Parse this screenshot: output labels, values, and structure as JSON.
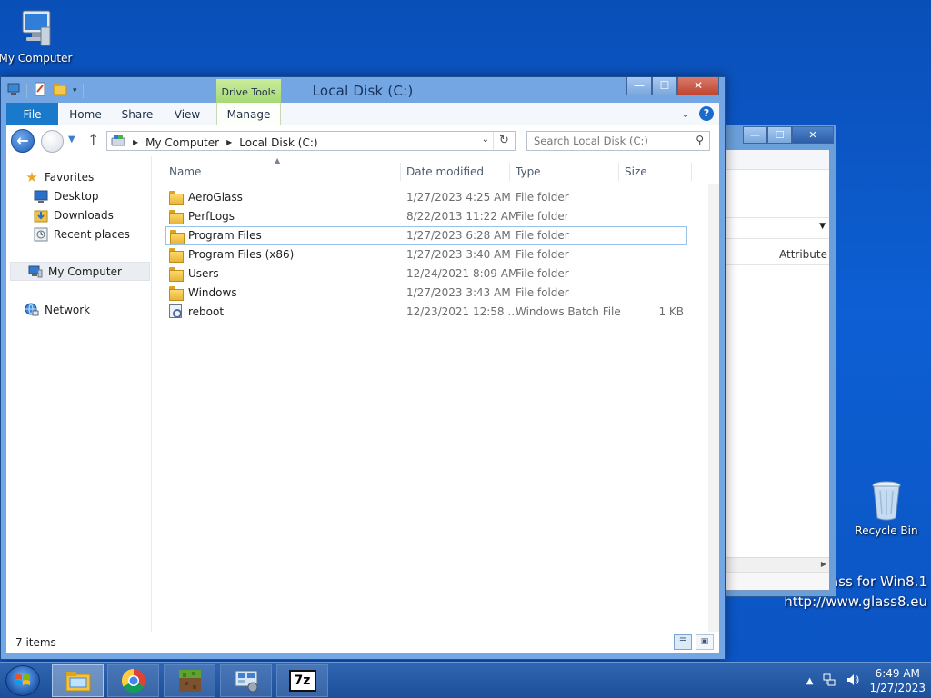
{
  "desktop": {
    "icons": [
      {
        "label": "My Computer"
      },
      {
        "label": "Recycle Bin"
      }
    ],
    "watermark": {
      "line1": "Glass for Win8.1",
      "line2": "http://www.glass8.eu"
    }
  },
  "background_window": {
    "column_header": "Attribute",
    "buttons": {
      "minimize": "—",
      "maximize": "☐",
      "close": "✕"
    }
  },
  "window": {
    "title": "Local Disk (C:)",
    "context_tab": "Drive Tools",
    "tabs": [
      "File",
      "Home",
      "Share",
      "View",
      "Manage"
    ],
    "buttons": {
      "minimize": "—",
      "maximize": "☐",
      "close": "✕"
    },
    "help": "?",
    "collapse": "⌄"
  },
  "address": {
    "crumbs": [
      "My Computer",
      "Local Disk (C:)"
    ],
    "back": "←",
    "up": "↑",
    "refresh": "↻"
  },
  "search": {
    "placeholder": "Search Local Disk (C:)"
  },
  "nav_pane": {
    "favorites_label": "Favorites",
    "favorites": [
      "Desktop",
      "Downloads",
      "Recent places"
    ],
    "computer": "My Computer",
    "network": "Network"
  },
  "columns": [
    "Name",
    "Date modified",
    "Type",
    "Size"
  ],
  "files": [
    {
      "name": "AeroGlass",
      "date": "1/27/2023 4:25 AM",
      "type": "File folder",
      "size": "",
      "kind": "folder"
    },
    {
      "name": "PerfLogs",
      "date": "8/22/2013 11:22 AM",
      "type": "File folder",
      "size": "",
      "kind": "folder"
    },
    {
      "name": "Program Files",
      "date": "1/27/2023 6:28 AM",
      "type": "File folder",
      "size": "",
      "kind": "folder",
      "focused": true
    },
    {
      "name": "Program Files (x86)",
      "date": "1/27/2023 3:40 AM",
      "type": "File folder",
      "size": "",
      "kind": "folder"
    },
    {
      "name": "Users",
      "date": "12/24/2021 8:09 AM",
      "type": "File folder",
      "size": "",
      "kind": "folder"
    },
    {
      "name": "Windows",
      "date": "1/27/2023 3:43 AM",
      "type": "File folder",
      "size": "",
      "kind": "folder"
    },
    {
      "name": "reboot",
      "date": "12/23/2021 12:58 ...",
      "type": "Windows Batch File",
      "size": "1 KB",
      "kind": "bat"
    }
  ],
  "status": {
    "item_count": "7 items"
  },
  "taskbar": {
    "items": [
      "file-explorer-icon",
      "chrome-icon",
      "minecraft-icon",
      "control-panel-icon",
      "7zip-icon"
    ],
    "sevenzip_label": "7z",
    "clock_time": "6:49 AM",
    "clock_date": "1/27/2023"
  },
  "colors": {
    "desktop_blue": "#0d5fd3",
    "file_tab": "#1979ca",
    "drive_tools": "#a6d874",
    "window_frame": "#73a6e2"
  }
}
